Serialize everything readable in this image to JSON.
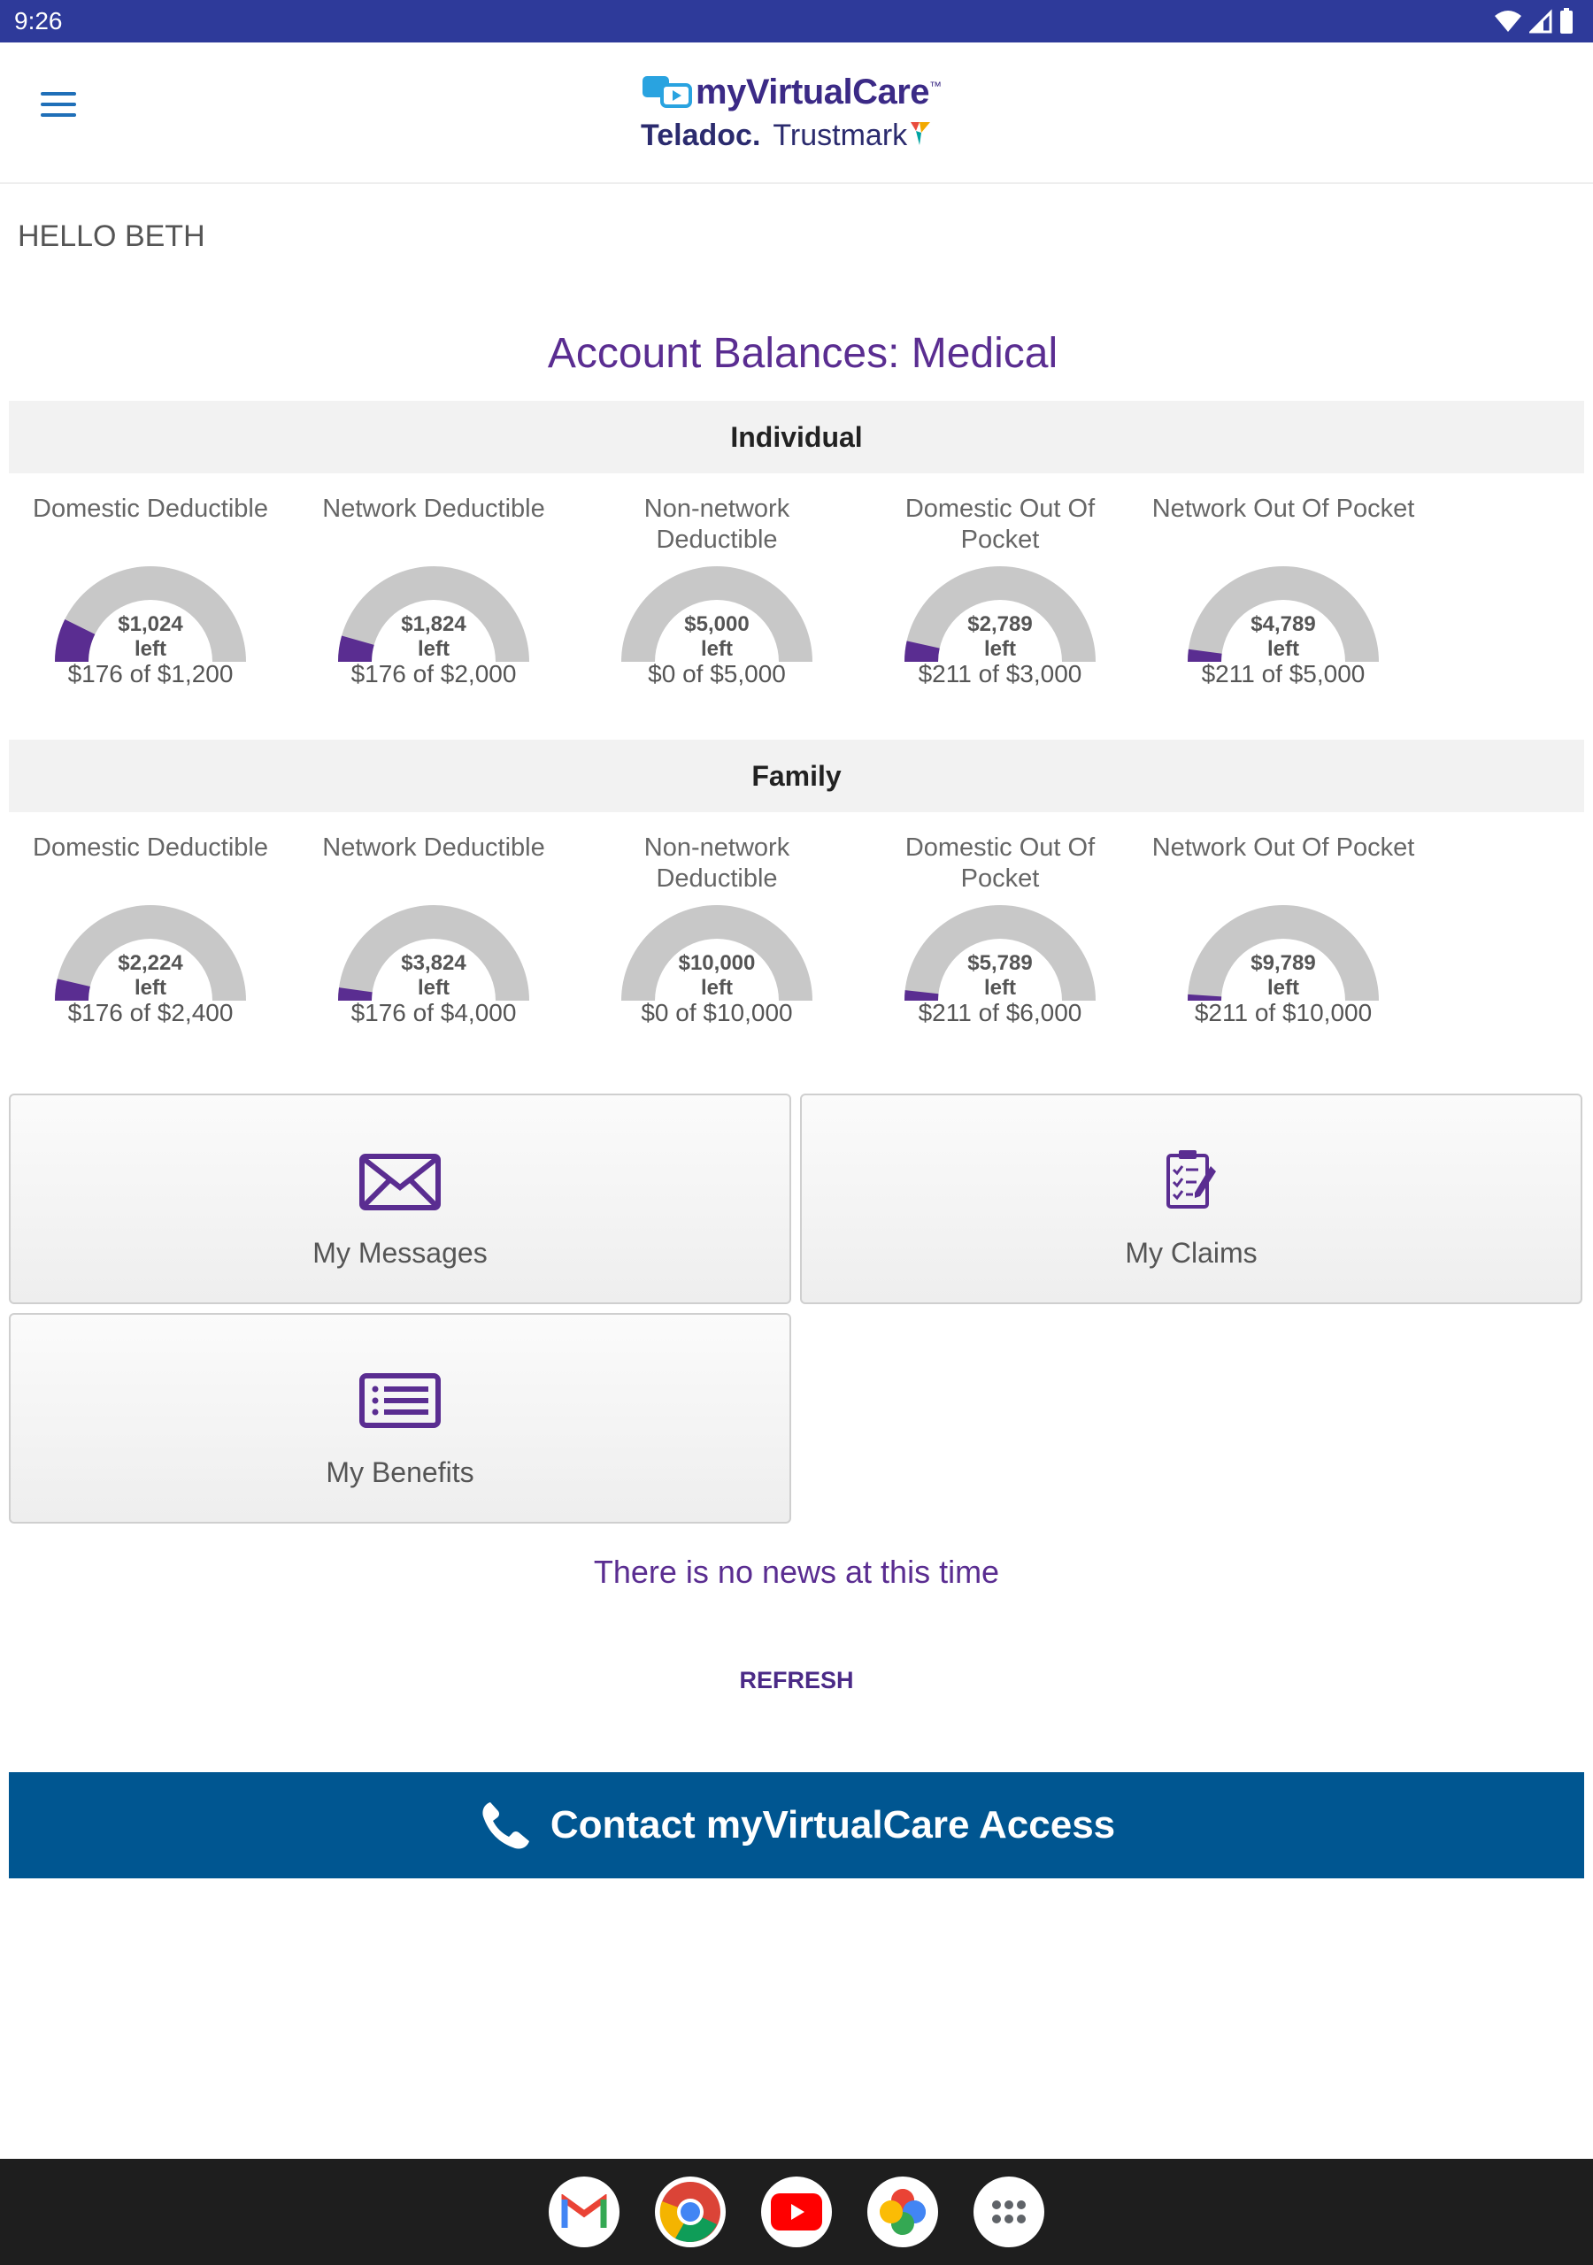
{
  "status_bar": {
    "time": "9:26"
  },
  "header": {
    "menu_icon": "hamburger-menu-icon",
    "logo_main": "myVirtualCare",
    "logo_tm": "™",
    "logo_teladoc": "Teladoc.",
    "logo_trustmark": "Trustmark"
  },
  "greeting": "HELLO BETH",
  "balances": {
    "title": "Account Balances:  Medical",
    "colors": {
      "progress": "#5a2d91",
      "track": "#c8c8c8"
    },
    "individual": {
      "label": "Individual",
      "gauges": [
        {
          "label": "Domestic Deductible",
          "left": "$1,024",
          "left_word": "left",
          "used": 176,
          "total": 1200,
          "summary": "$176 of $1,200"
        },
        {
          "label": "Network Deductible",
          "left": "$1,824",
          "left_word": "left",
          "used": 176,
          "total": 2000,
          "summary": "$176 of $2,000"
        },
        {
          "label": "Non-network Deductible",
          "left": "$5,000",
          "left_word": "left",
          "used": 0,
          "total": 5000,
          "summary": "$0 of $5,000"
        },
        {
          "label": "Domestic Out Of Pocket",
          "left": "$2,789",
          "left_word": "left",
          "used": 211,
          "total": 3000,
          "summary": "$211 of $3,000"
        },
        {
          "label": "Network Out Of Pocket",
          "left": "$4,789",
          "left_word": "left",
          "used": 211,
          "total": 5000,
          "summary": "$211 of $5,000"
        }
      ]
    },
    "family": {
      "label": "Family",
      "gauges": [
        {
          "label": "Domestic Deductible",
          "left": "$2,224",
          "left_word": "left",
          "used": 176,
          "total": 2400,
          "summary": "$176 of $2,400"
        },
        {
          "label": "Network Deductible",
          "left": "$3,824",
          "left_word": "left",
          "used": 176,
          "total": 4000,
          "summary": "$176 of $4,000"
        },
        {
          "label": "Non-network Deductible",
          "left": "$10,000",
          "left_word": "left",
          "used": 0,
          "total": 10000,
          "summary": "$0 of $10,000"
        },
        {
          "label": "Domestic Out Of Pocket",
          "left": "$5,789",
          "left_word": "left",
          "used": 211,
          "total": 6000,
          "summary": "$211 of $6,000"
        },
        {
          "label": "Network Out Of Pocket",
          "left": "$9,789",
          "left_word": "left",
          "used": 211,
          "total": 10000,
          "summary": "$211 of $10,000"
        }
      ]
    }
  },
  "tiles": [
    {
      "label": "My Messages",
      "icon": "envelope-icon"
    },
    {
      "label": "My Claims",
      "icon": "clipboard-icon"
    },
    {
      "label": "My Benefits",
      "icon": "list-icon"
    }
  ],
  "news": "There is no news at this time",
  "refresh_label": "REFRESH",
  "contact": {
    "label": "Contact myVirtualCare Access",
    "icon": "phone-icon"
  },
  "dock": [
    "gmail-icon",
    "chrome-icon",
    "youtube-icon",
    "photos-icon",
    "apps-icon"
  ]
}
